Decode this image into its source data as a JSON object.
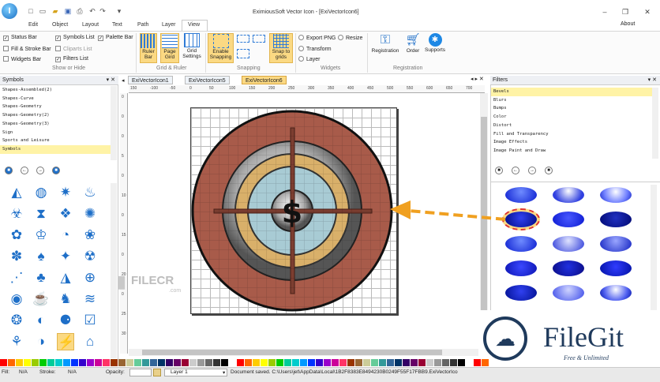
{
  "app": {
    "title": "EximiousSoft Vector Icon - [ExiVectorIcon6]",
    "logo_letter": "I",
    "about": "About"
  },
  "menu": [
    "Edit",
    "Object",
    "Layout",
    "Text",
    "Path",
    "Layer",
    "View"
  ],
  "ribbon": {
    "show_or_hide": {
      "label": "Show or Hide",
      "items": [
        {
          "label": "Status Bar",
          "checked": true
        },
        {
          "label": "Symbols List",
          "checked": true
        },
        {
          "label": "Palette Bar",
          "checked": true
        },
        {
          "label": "Fill & Stroke Bar",
          "checked": false
        },
        {
          "label": "Cliparts List",
          "checked": false
        },
        {
          "label": "Widgets Bar",
          "checked": false
        },
        {
          "label": "Filters List",
          "checked": true
        }
      ]
    },
    "grid_ruler": {
      "label": "Grid & Ruler",
      "buttons": [
        "Ruler Bar",
        "Page Gird",
        "Grid Settings"
      ]
    },
    "snapping": {
      "label": "Snapping",
      "buttons": [
        "Enable Snapping",
        "Snap to grids"
      ]
    },
    "widgets": {
      "label": "Widgets",
      "items": [
        "Export PNG",
        "Resize",
        "Transform",
        "Layer"
      ]
    },
    "registration": {
      "label": "Registration",
      "buttons": [
        "Registration",
        "Order",
        "Supports"
      ]
    }
  },
  "symbols_panel": {
    "title": "Symbols",
    "categories": [
      "Shapes-Assembled(2)",
      "Shapes-Curve",
      "Shapes-Geometry",
      "Shapes-Geometry(2)",
      "Shapes-Geometry(3)",
      "Sign",
      "Sports and Leisure",
      "Symbols"
    ],
    "selected": "Symbols"
  },
  "doc_tabs": [
    "ExiVectorIcon1",
    "ExiVectorIcon5",
    "ExiVectorIcon6"
  ],
  "ruler": {
    "numbers": [
      "150",
      "-100",
      "-50",
      "0",
      "50",
      "100",
      "150",
      "200",
      "250",
      "300",
      "350",
      "400",
      "450",
      "500",
      "550",
      "600",
      "650",
      "700"
    ],
    "v_numbers": [
      "0",
      "0",
      "0",
      "5",
      "0",
      "10",
      "0",
      "15",
      "0",
      "20",
      "0",
      "25",
      "30"
    ]
  },
  "canvas": {
    "symbol": "$",
    "watermark_left": "FILECR",
    "watermark_left_sub": ".com"
  },
  "filters_panel": {
    "title": "Filters",
    "categories": [
      "Bevels",
      "Blurs",
      "Bumps",
      "Color",
      "Distort",
      "Fill and Transparency",
      "Image Effects",
      "Image Paint and Draw"
    ],
    "selected": "Bevels"
  },
  "watermark": {
    "brand": "FileGit",
    "tagline": "Free & Unlimited"
  },
  "status": {
    "fill_label": "Fill:",
    "fill_value": "N/A",
    "stroke_label": "Stroke:",
    "stroke_value": "N/A",
    "opacity_label": "Opacity:",
    "layer": "Layer 1",
    "message": "Document saved. C:\\Users\\jet\\AppData\\Local\\1B2F8383E8494230B0249F55F17FBB9.ExiVectorIco"
  },
  "colors": {
    "accent": "#1e6fc8",
    "selection": "#fbd983",
    "arrow": "#f0a020",
    "target_outer": "#a85b4a",
    "target_ring": "#d9b06a"
  }
}
